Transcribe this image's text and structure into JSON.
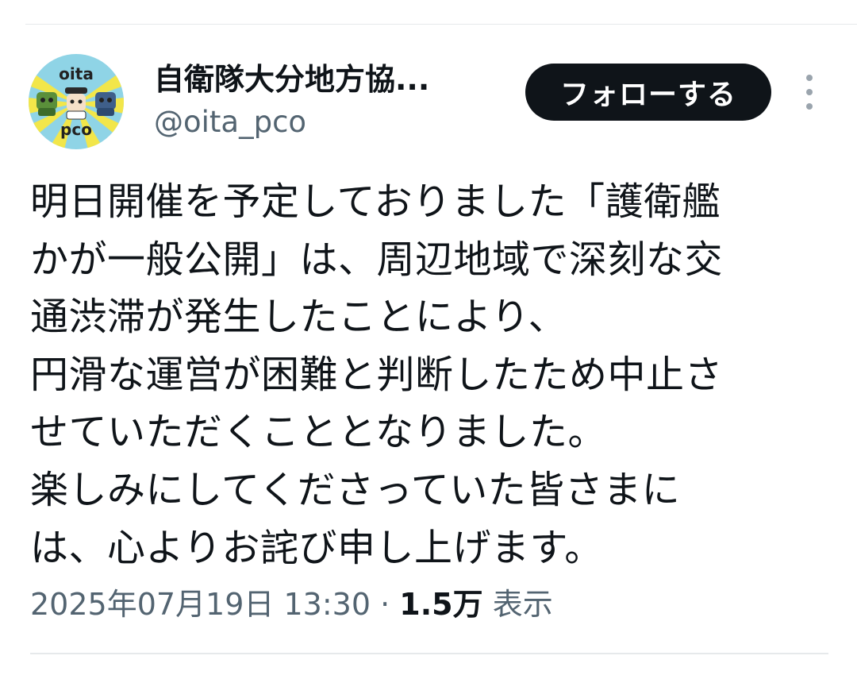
{
  "author": {
    "display_name": "自衛隊大分地方協...",
    "handle": "@oita_pco",
    "avatar_text_top": "oita",
    "avatar_text_bottom": "pco"
  },
  "follow_button": {
    "label": "フォローする"
  },
  "more_menu": {
    "icon": "vertical-ellipsis-icon"
  },
  "tweet": {
    "lines": [
      "明日開催を予定しておりました「護衛艦",
      "かが一般公開」は、周辺地域で深刻な交",
      "通渋滞が発生したことにより、",
      "円滑な運営が困難と判断したため中止さ",
      "せていただくこととなりました。",
      "楽しみにしてくださっていた皆さまに",
      "は、心よりお詫び申し上げます。"
    ]
  },
  "meta": {
    "timestamp": "2025年07月19日 13:30",
    "separator": "·",
    "views_count": "1.5万",
    "views_label": "表示"
  },
  "colors": {
    "follow_button_bg": "#0f1419",
    "text_primary": "#0f1419",
    "text_secondary": "#536471",
    "avatar_bg": "#8fd4e6",
    "avatar_burst": "#f2e64a"
  }
}
